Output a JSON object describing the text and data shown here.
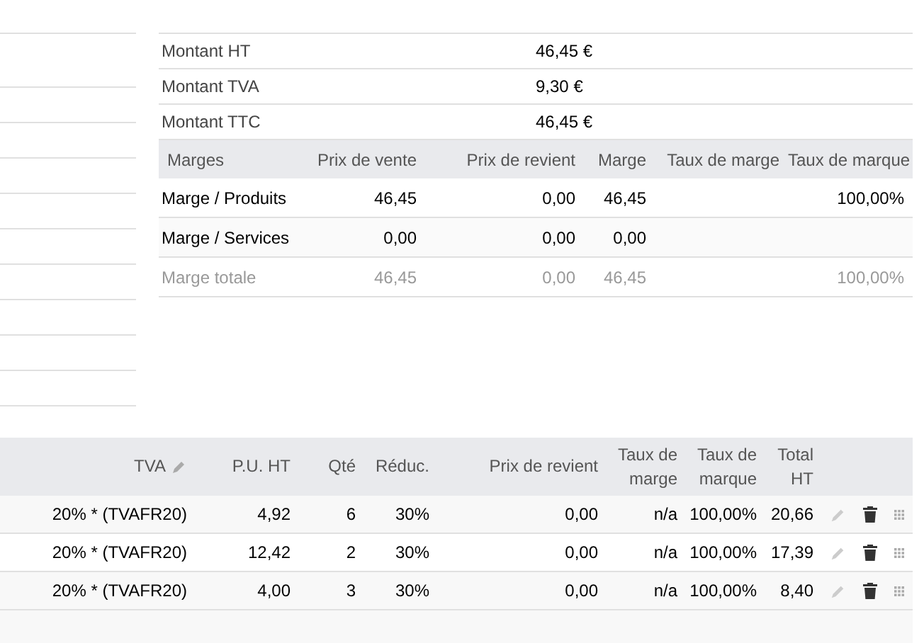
{
  "totals": [
    {
      "label": "Montant HT",
      "value": "46,45 €"
    },
    {
      "label": "Montant TVA",
      "value": "9,30 €"
    },
    {
      "label": "Montant TTC",
      "value": "46,45 €"
    }
  ],
  "margins": {
    "columns": [
      "Marges",
      "Prix de vente",
      "Prix de revient",
      "Marge",
      "Taux de marge",
      "Taux de marque"
    ],
    "rows": [
      {
        "kind": "line",
        "cells": [
          "Marge / Produits",
          "46,45",
          "0,00",
          "46,45",
          "",
          "100,00%"
        ]
      },
      {
        "kind": "line",
        "cells": [
          "Marge / Services",
          "0,00",
          "0,00",
          "0,00",
          "",
          ""
        ]
      },
      {
        "kind": "total",
        "cells": [
          "Marge totale",
          "46,45",
          "0,00",
          "46,45",
          "",
          "100,00%"
        ]
      }
    ]
  },
  "lines": {
    "columns": [
      "TVA",
      "P.U. HT",
      "Qté",
      "Réduc.",
      "Prix de revient",
      "Taux de marge",
      "Taux de marque",
      "Total HT"
    ],
    "rows": [
      {
        "cells": [
          "20% * (TVAFR20)",
          "4,92",
          "6",
          "30%",
          "0,00",
          "n/a",
          "100,00%",
          "20,66"
        ]
      },
      {
        "cells": [
          "20% * (TVAFR20)",
          "12,42",
          "2",
          "30%",
          "0,00",
          "n/a",
          "100,00%",
          "17,39"
        ]
      },
      {
        "cells": [
          "20% * (TVAFR20)",
          "4,00",
          "3",
          "30%",
          "0,00",
          "n/a",
          "100,00%",
          "8,40"
        ]
      }
    ]
  }
}
